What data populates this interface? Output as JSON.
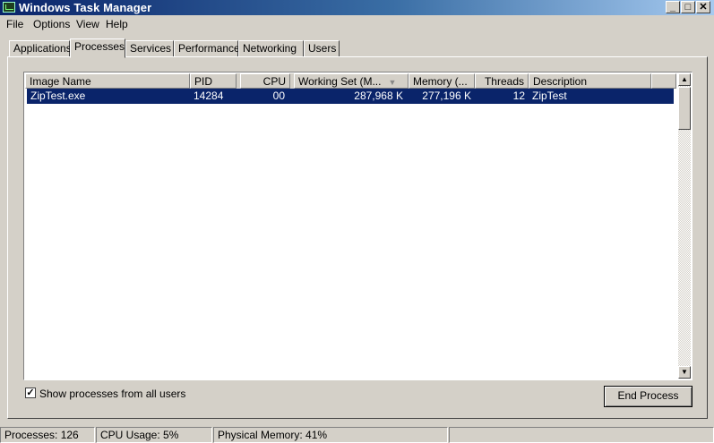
{
  "window": {
    "title": "Windows Task Manager"
  },
  "menu": [
    "File",
    "Options",
    "View",
    "Help"
  ],
  "tabs": [
    "Applications",
    "Processes",
    "Services",
    "Performance",
    "Networking",
    "Users"
  ],
  "active_tab": "Processes",
  "columns": [
    "Image Name",
    "PID",
    "CPU",
    "Working Set (M...",
    "Memory (...",
    "Threads",
    "Description"
  ],
  "sorted_column": "Working Set (M...",
  "rows": [
    {
      "image_name": "ZipTest.exe",
      "pid": "14284",
      "cpu": "00",
      "working_set": "287,968 K",
      "memory": "277,196 K",
      "threads": "12",
      "description": "ZipTest",
      "selected": true
    }
  ],
  "show_all_users": {
    "label": "Show processes from all users",
    "checked": true
  },
  "end_process_label": "End Process",
  "status": {
    "processes": "Processes: 126",
    "cpu": "CPU Usage: 5%",
    "memory": "Physical Memory: 41%"
  },
  "icons": {
    "app": "task-manager-icon",
    "sort": "sort-descending-icon",
    "check": "checkmark-icon"
  },
  "colors": {
    "title_start": "#0a246a",
    "title_end": "#a6caf0",
    "selection": "#0a246a",
    "face": "#d4d0c8"
  }
}
